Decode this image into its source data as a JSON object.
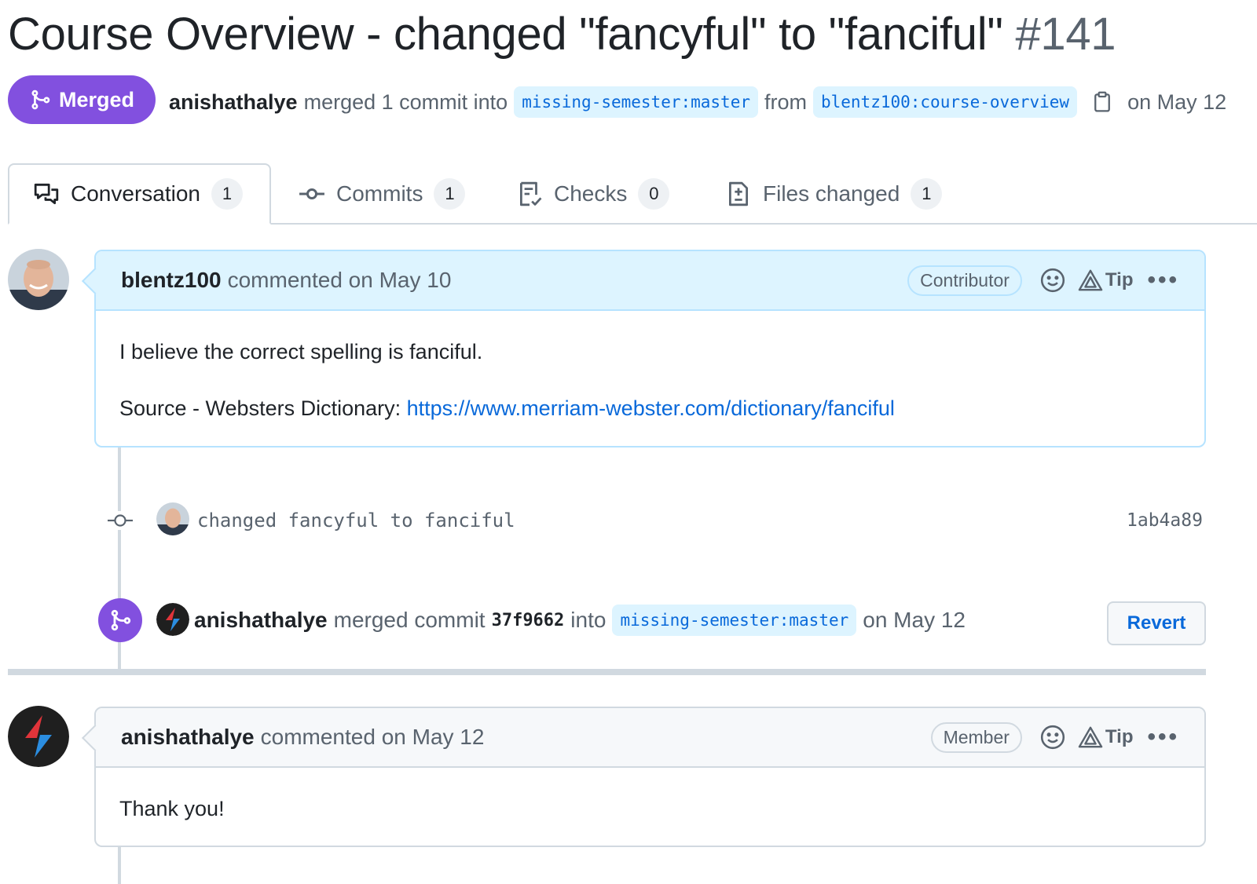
{
  "pr": {
    "title": "Course Overview - changed \"fancyful\" to \"fanciful\"",
    "number": "#141",
    "state": "Merged",
    "merged_by": "anishathalye",
    "merge_text_1": "merged 1 commit into",
    "base_branch": "missing-semester:master",
    "from_text": "from",
    "head_branch": "blentz100:course-overview",
    "merge_date": "on May 12"
  },
  "tabs": [
    {
      "label": "Conversation",
      "count": "1",
      "icon": "comment-discussion-icon"
    },
    {
      "label": "Commits",
      "count": "1",
      "icon": "git-commit-icon"
    },
    {
      "label": "Checks",
      "count": "0",
      "icon": "checklist-icon"
    },
    {
      "label": "Files changed",
      "count": "1",
      "icon": "file-diff-icon"
    }
  ],
  "comment1": {
    "author": "blentz100",
    "action": "commented on May 10",
    "role": "Contributor",
    "tip": "Tip",
    "body_line1": "I believe the correct spelling is fanciful.",
    "source_label": "Source - Websters Dictionary:",
    "source_link": "https://www.merriam-webster.com/dictionary/fanciful"
  },
  "commit": {
    "message": "changed fancyful to fanciful",
    "sha": "1ab4a89"
  },
  "merge_event": {
    "author": "anishathalye",
    "text1": "merged commit",
    "sha": "37f9662",
    "text2": "into",
    "branch": "missing-semester:master",
    "date": "on May 12",
    "revert_label": "Revert"
  },
  "comment2": {
    "author": "anishathalye",
    "action": "commented on May 12",
    "role": "Member",
    "tip": "Tip",
    "body": "Thank you!"
  },
  "colors": {
    "merged_purple": "#8250df",
    "link_blue": "#0969da",
    "branch_bg": "#ddf4ff",
    "header_blue_bg": "#ddf4ff",
    "border_grey": "#d1d9e0"
  }
}
